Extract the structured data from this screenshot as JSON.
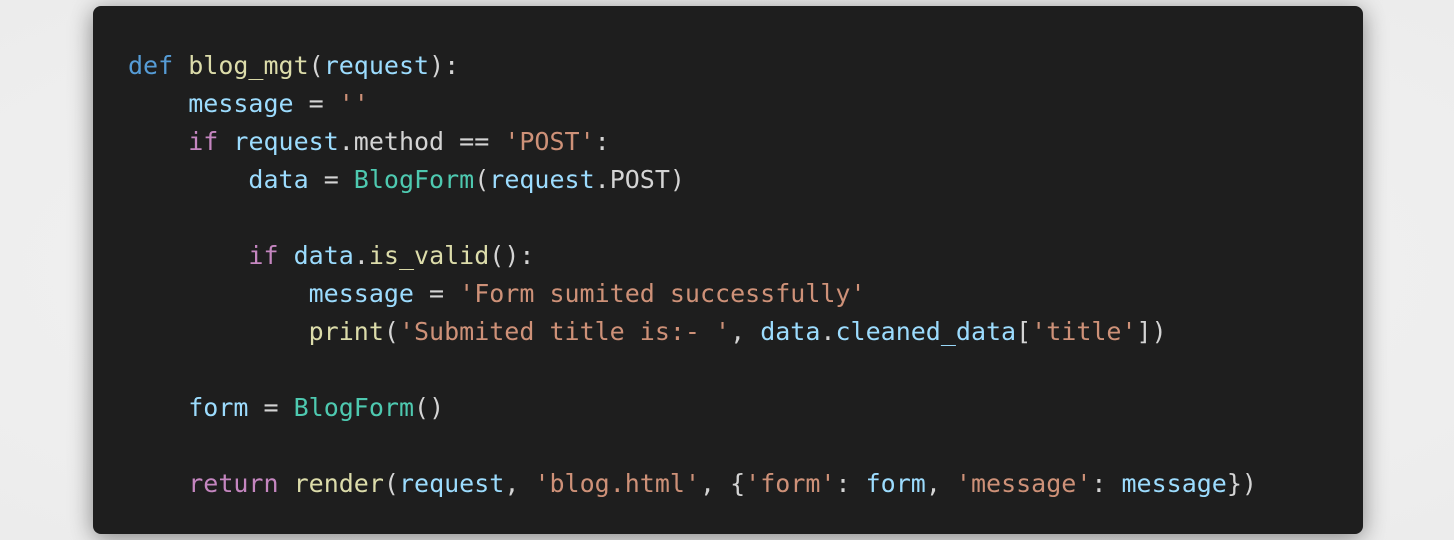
{
  "colors": {
    "background": "#1e1e1e",
    "keyword": "#569cd6",
    "control": "#c586c0",
    "function": "#dcdcaa",
    "variable": "#9cdcfe",
    "class": "#4ec9b0",
    "string": "#ce9178",
    "punctuation": "#d4d4d4"
  },
  "code": {
    "lines": [
      {
        "indent": "",
        "tokens": [
          {
            "t": "kw",
            "v": "def"
          },
          {
            "t": "pun",
            "v": " "
          },
          {
            "t": "fn",
            "v": "blog_mgt"
          },
          {
            "t": "pun",
            "v": "("
          },
          {
            "t": "var",
            "v": "request"
          },
          {
            "t": "pun",
            "v": "):"
          }
        ]
      },
      {
        "indent": "    ",
        "tokens": [
          {
            "t": "var",
            "v": "message"
          },
          {
            "t": "pun",
            "v": " = "
          },
          {
            "t": "str",
            "v": "''"
          }
        ]
      },
      {
        "indent": "    ",
        "tokens": [
          {
            "t": "ctl",
            "v": "if"
          },
          {
            "t": "pun",
            "v": " "
          },
          {
            "t": "var",
            "v": "request"
          },
          {
            "t": "pun",
            "v": ".method == "
          },
          {
            "t": "str",
            "v": "'POST'"
          },
          {
            "t": "pun",
            "v": ":"
          }
        ]
      },
      {
        "indent": "        ",
        "tokens": [
          {
            "t": "var",
            "v": "data"
          },
          {
            "t": "pun",
            "v": " = "
          },
          {
            "t": "cls",
            "v": "BlogForm"
          },
          {
            "t": "pun",
            "v": "("
          },
          {
            "t": "var",
            "v": "request"
          },
          {
            "t": "pun",
            "v": ".POST)"
          }
        ]
      },
      {
        "indent": "",
        "tokens": []
      },
      {
        "indent": "        ",
        "tokens": [
          {
            "t": "ctl",
            "v": "if"
          },
          {
            "t": "pun",
            "v": " "
          },
          {
            "t": "var",
            "v": "data"
          },
          {
            "t": "pun",
            "v": "."
          },
          {
            "t": "fn",
            "v": "is_valid"
          },
          {
            "t": "pun",
            "v": "():"
          }
        ]
      },
      {
        "indent": "            ",
        "tokens": [
          {
            "t": "var",
            "v": "message"
          },
          {
            "t": "pun",
            "v": " = "
          },
          {
            "t": "str",
            "v": "'Form sumited successfully'"
          }
        ]
      },
      {
        "indent": "            ",
        "tokens": [
          {
            "t": "fn",
            "v": "print"
          },
          {
            "t": "pun",
            "v": "("
          },
          {
            "t": "str",
            "v": "'Submited title is:- '"
          },
          {
            "t": "pun",
            "v": ", "
          },
          {
            "t": "var",
            "v": "data"
          },
          {
            "t": "pun",
            "v": "."
          },
          {
            "t": "var",
            "v": "cleaned_data"
          },
          {
            "t": "pun",
            "v": "["
          },
          {
            "t": "str",
            "v": "'title'"
          },
          {
            "t": "pun",
            "v": "])"
          }
        ]
      },
      {
        "indent": "",
        "tokens": []
      },
      {
        "indent": "    ",
        "tokens": [
          {
            "t": "var",
            "v": "form"
          },
          {
            "t": "pun",
            "v": " = "
          },
          {
            "t": "cls",
            "v": "BlogForm"
          },
          {
            "t": "pun",
            "v": "()"
          }
        ]
      },
      {
        "indent": "",
        "tokens": []
      },
      {
        "indent": "    ",
        "tokens": [
          {
            "t": "ctl",
            "v": "return"
          },
          {
            "t": "pun",
            "v": " "
          },
          {
            "t": "fn",
            "v": "render"
          },
          {
            "t": "pun",
            "v": "("
          },
          {
            "t": "var",
            "v": "request"
          },
          {
            "t": "pun",
            "v": ", "
          },
          {
            "t": "str",
            "v": "'blog.html'"
          },
          {
            "t": "pun",
            "v": ", {"
          },
          {
            "t": "str",
            "v": "'form'"
          },
          {
            "t": "pun",
            "v": ": "
          },
          {
            "t": "var",
            "v": "form"
          },
          {
            "t": "pun",
            "v": ", "
          },
          {
            "t": "str",
            "v": "'message'"
          },
          {
            "t": "pun",
            "v": ": "
          },
          {
            "t": "var",
            "v": "message"
          },
          {
            "t": "pun",
            "v": "})"
          }
        ]
      }
    ]
  }
}
